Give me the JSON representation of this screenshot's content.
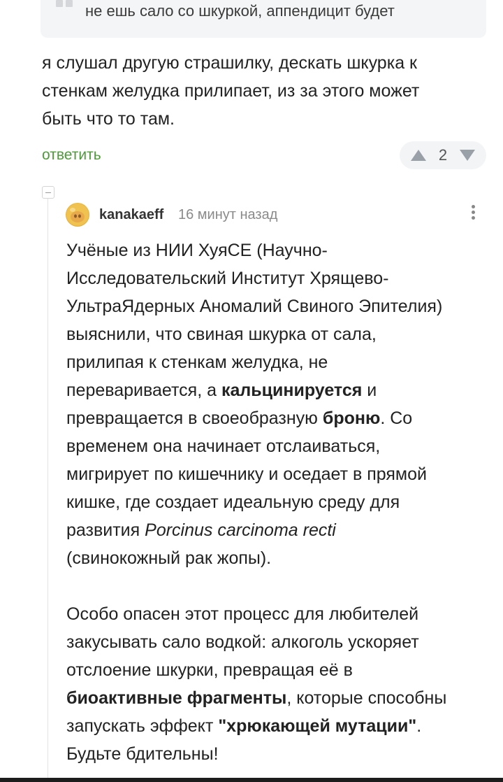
{
  "quote": {
    "text": "не ешь сало со шкуркой, аппендицит будет"
  },
  "comment1": {
    "lines": [
      "я слушал другую страшилку, дескать шкурка к",
      "стенкам желудка прилипает, из за этого может",
      "быть что то там."
    ],
    "reply_label": "ответить",
    "rating": "2"
  },
  "comment2": {
    "author": "kanakaeff",
    "time": "16 минут назад",
    "l1": "Учёные из НИИ ХуяСЕ (Научно-",
    "l2": "Исследовательский Институт Хрящево-",
    "l3": "УльтраЯдерных Аномалий Свиного Эпителия)",
    "l4": "выяснили, что свиная шкурка от сала,",
    "l5": "прилипая к стенкам желудка, не",
    "l6a": "переваривается, а ",
    "l6b": "кальцинируется",
    "l6c": " и",
    "l7a": "превращается в своеобразную ",
    "l7b": "броню",
    "l7c": ". Со",
    "l8": "временем она начинает отслаиваться,",
    "l9": "мигрирует по кишечнику и оседает в прямой",
    "l10": "кишке, где создает идеальную среду для",
    "l11a": "развития ",
    "l11b": "Porcinus carcinoma recti",
    "l12": "(свинокожный рак жопы).",
    "p2l1": "Особо опасен этот процесс для любителей",
    "p2l2": "закусывать сало водкой: алкоголь ускоряет",
    "p2l3": "отслоение шкурки, превращая её в",
    "p2l4a": "биоактивные фрагменты",
    "p2l4b": ", которые способны",
    "p2l5a": "запускать эффект ",
    "p2l5b": "\"хрюкающей мутации\"",
    "p2l5c": ".",
    "p2l6": "Будьте бдительны!"
  },
  "colors": {
    "reply_green": "#4d9b38",
    "quote_bg": "#f4f5f6",
    "rating_bg": "#f3f4f6"
  }
}
